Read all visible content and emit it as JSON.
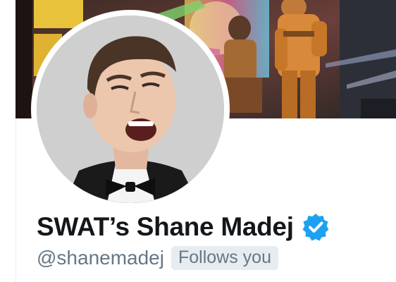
{
  "profile": {
    "display_name": "SWAT’s Shane Madej",
    "handle": "@shanemadej",
    "follows_you_label": "Follows you",
    "verified": true
  },
  "colors": {
    "text_primary": "#14171a",
    "text_secondary": "#657786",
    "badge_bg": "#e6ecf0",
    "verified_blue": "#1da1f2"
  },
  "icons": {
    "verified": "verified-badge-icon"
  }
}
